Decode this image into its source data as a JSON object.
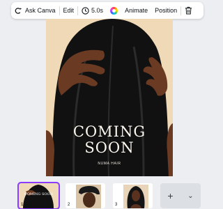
{
  "toolbar": {
    "ask_label": "Ask Canva",
    "edit_label": "Edit",
    "duration": "5.0s",
    "animate_label": "Animate",
    "position_label": "Position"
  },
  "design": {
    "headline_line1": "COMING",
    "headline_line2": "SOON",
    "brand": "NUMA HAIR"
  },
  "pages": {
    "p1_label": "1",
    "p1_title": "COMING SOON",
    "p2_label": "2",
    "p3_label": "3",
    "selected": 1
  },
  "pager": {
    "add_symbol": "+",
    "more_symbol": "⌄"
  },
  "colors": {
    "accent": "#8b3dff",
    "canvas_bg": "#efd9b6",
    "hair": "#111111",
    "skin": "#6a3a22"
  }
}
